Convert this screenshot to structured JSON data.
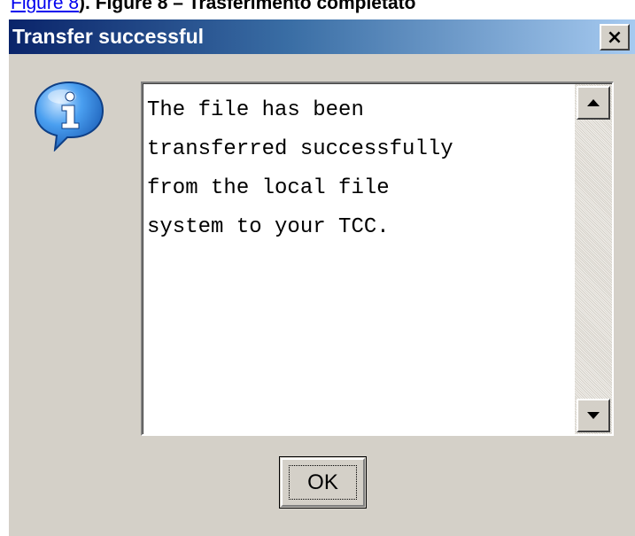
{
  "caption": {
    "link_text": "Figure 8",
    "text": "). Figure 8 – Trasferimento completato"
  },
  "dialog": {
    "title": "Transfer successful",
    "close_label": "×",
    "icon": "info-balloon-icon",
    "message": "The file has been\ntransferred successfully\nfrom the local file\nsystem to your TCC.",
    "ok_label": "OK"
  },
  "colors": {
    "title_bar_start": "#0a246a",
    "title_bar_end": "#a6caf0",
    "dialog_face": "#d4d0c8",
    "icon_blue": "#2f86e3"
  }
}
